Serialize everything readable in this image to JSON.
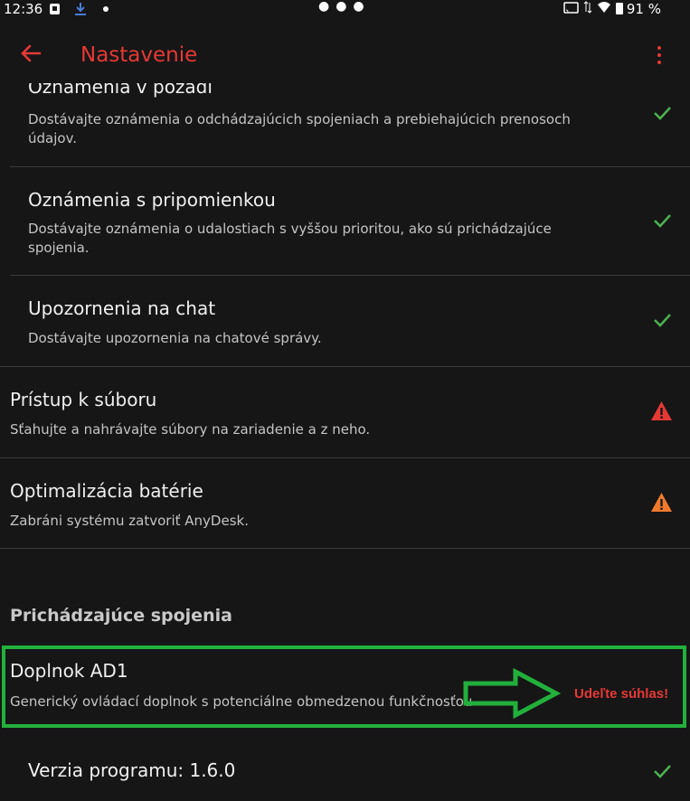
{
  "status_bar": {
    "time": "12:36",
    "battery": "91 %"
  },
  "app_bar": {
    "title": "Nastavenie"
  },
  "settings": [
    {
      "label": "Oznámenia v pozadí",
      "description": "Dostávajte oznámenia o odchádzajúcich spojeniach a prebiehajúcich prenosoch údajov.",
      "status": "check"
    },
    {
      "label": "Oznámenia s pripomienkou",
      "description": "Dostávajte oznámenia o udalostiach s vyššou prioritou, ako sú prichádzajúce spojenia.",
      "status": "check"
    },
    {
      "label": "Upozornenia na chat",
      "description": "Dostávajte upozornenia na chatové správy.",
      "status": "check"
    },
    {
      "label": "Prístup k súboru",
      "description": "Sťahujte a nahrávajte súbory na zariadenie a z neho.",
      "status": "warning-red"
    },
    {
      "label": "Optimalizácia batérie",
      "description": "Zabráni systému zatvoriť AnyDesk.",
      "status": "warning-orange"
    }
  ],
  "incoming": {
    "section_title": "Prichádzajúce spojenia",
    "plugin": {
      "label": "Doplnok AD1",
      "description": "Generický ovládací doplnok s potenciálne obmedzenou funkčnosťou",
      "action": "Udeľte súhlas!"
    }
  },
  "version": {
    "label": "Verzia programu: 1.6.0",
    "status": "check"
  },
  "colors": {
    "accent": "#e53935",
    "check": "#4caf50",
    "warning_red": "#e53935",
    "warning_orange": "#f07a2c",
    "highlight": "#22b03c"
  },
  "icons": {
    "back": "arrow-left-icon",
    "menu": "more-vert-icon",
    "check": "check-icon",
    "warning": "warning-triangle-icon"
  }
}
